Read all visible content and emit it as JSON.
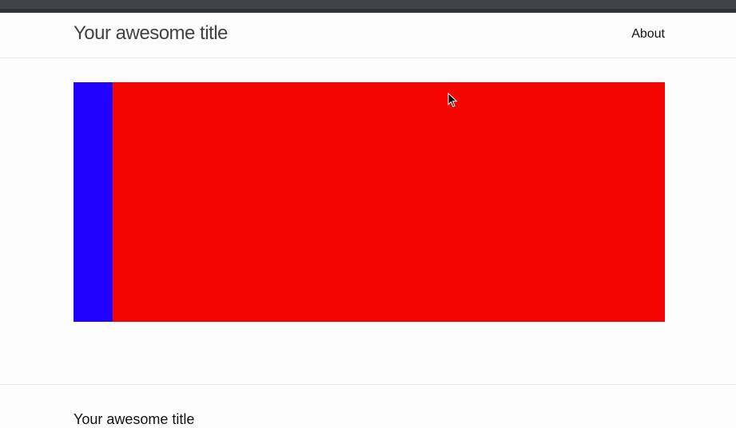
{
  "header": {
    "site_title": "Your awesome title",
    "nav": [
      "About"
    ]
  },
  "main": {
    "colors": {
      "primary_block": "#f50400",
      "side_bar": "#2000ff"
    }
  },
  "footer": {
    "heading": "Your awesome title"
  }
}
